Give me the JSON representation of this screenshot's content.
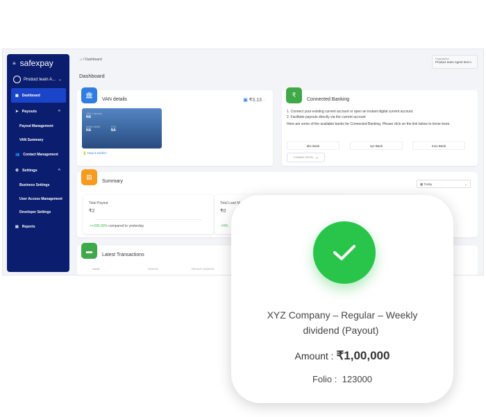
{
  "sidebar": {
    "brand": "safexpay",
    "user": "Product team A...",
    "items": [
      {
        "label": "Dashboard"
      },
      {
        "label": "Payouts"
      },
      {
        "label": "Payout Management"
      },
      {
        "label": "VAN Summary"
      },
      {
        "label": "Contact Management"
      },
      {
        "label": "Settings"
      },
      {
        "label": "Business Settings"
      },
      {
        "label": "User Access Management"
      },
      {
        "label": "Developer Settings"
      },
      {
        "label": "Reports"
      }
    ]
  },
  "header": {
    "breadcrumb": "Dashboard",
    "title": "Dashboard",
    "org_label": "Organization",
    "org_value": "Product team Agent test A"
  },
  "van": {
    "title": "VAN details",
    "balance": "₹3.13",
    "number_label": "VAN 1 Number",
    "number": "NA",
    "bank_label": "BANK NAME",
    "bank": "NA",
    "ifsc_label": "IFSC",
    "ifsc": "NA",
    "help": "How it works?"
  },
  "banking": {
    "title": "Connected Banking",
    "line1": "1. Connect your existing current account or open an instant digital current account.",
    "line2": "2. Facilitate payouts directly via the current account",
    "line3": "Here are some of the available banks for Connected Banking. Please click on the link below to know more.",
    "banks": [
      "abc Bank",
      "xyz Bank",
      "mno Bank"
    ],
    "coming": "COMING SOON..."
  },
  "summary": {
    "title": "Summary",
    "period": "Today",
    "cards": [
      {
        "label": "Total Payout",
        "value": "₹2",
        "change": "+200.00%",
        "suffix": "compared to yesterday"
      },
      {
        "label": "Total Load M",
        "value": "₹0",
        "change": "0%"
      }
    ]
  },
  "transactions": {
    "title": "Latest Transactions",
    "columns": [
      "NAME",
      "STATUS",
      "PAYOUT SOURCE"
    ]
  },
  "popup": {
    "line1": "XYZ Company  – Regular – Weekly",
    "line2": "dividend (Payout)",
    "amount_label": "Amount :",
    "amount": "₹1,00,000",
    "folio_label": "Folio :",
    "folio": "123000"
  },
  "colors": {
    "sidebar": "#0b1d6e",
    "active": "#1b45c9",
    "success": "#29c44a"
  }
}
